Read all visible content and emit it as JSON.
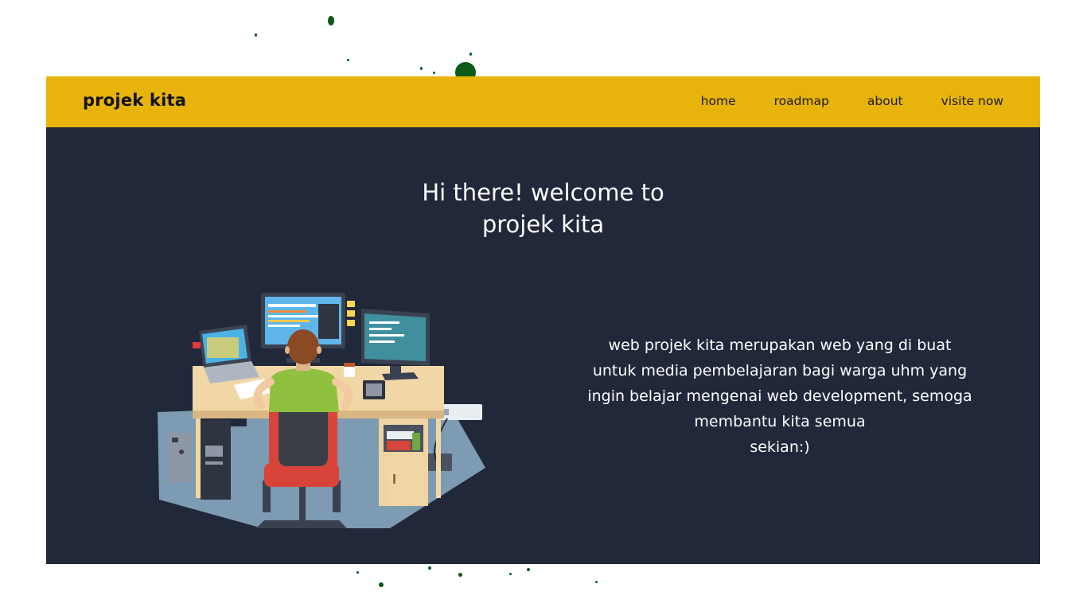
{
  "navbar": {
    "brand": "projek kita",
    "links": [
      {
        "label": "home"
      },
      {
        "label": "roadmap"
      },
      {
        "label": "about"
      },
      {
        "label": "visite now"
      }
    ]
  },
  "hero": {
    "title_line1": "Hi there! welcome to",
    "title_line2": "projek kita",
    "description_lines": [
      "web projek kita merupakan web yang di buat",
      "untuk media pembelajaran bagi warga uhm yang",
      "ingin belajar mengenai web development, semoga",
      "membantu kita semua",
      "sekian:)"
    ]
  },
  "illustration": {
    "icon": "developer-workstation-illustration"
  },
  "colors": {
    "navbar_bg": "#e8b40b",
    "page_bg": "#20283a",
    "splatter": "#0b5a16",
    "text_light": "#ffffff",
    "text_dark": "#111111"
  }
}
